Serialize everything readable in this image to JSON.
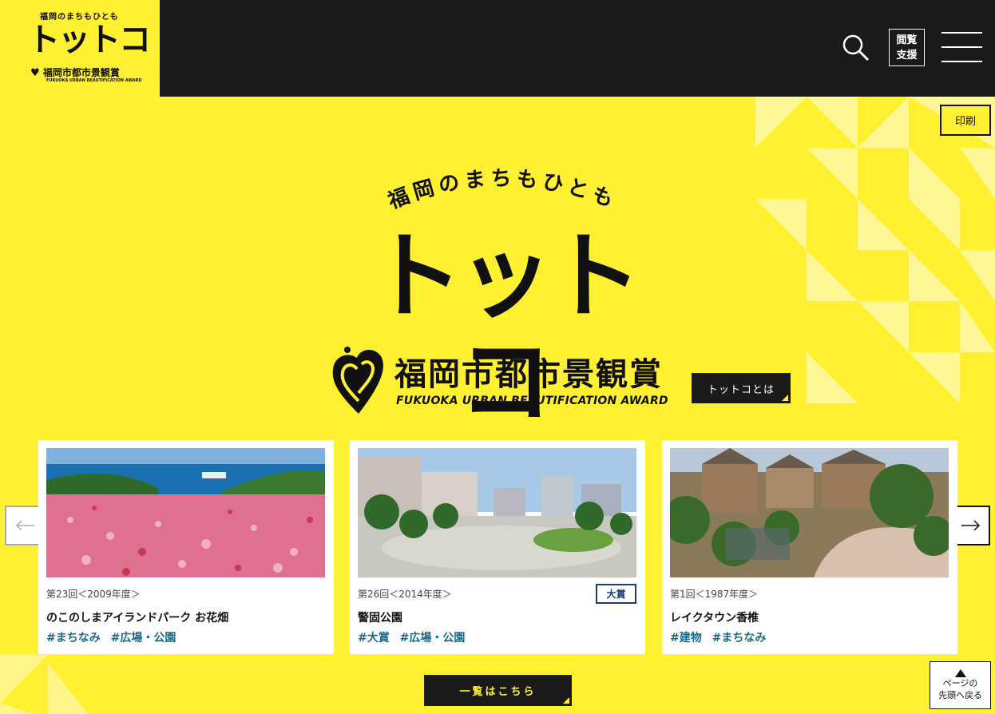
{
  "logo": {
    "sub": "福岡のまちもひとも",
    "main": "トットコ",
    "award": "福岡市都市景観賞",
    "award_en": "FUKUOKA URBAN BEAUTIFICATION AWARD"
  },
  "header": {
    "assist_line1": "閲覧",
    "assist_line2": "支援"
  },
  "print_label": "印刷",
  "hero": {
    "subtitle": "福岡のまちもひとも",
    "title": "トットコ",
    "award_jp": "福岡市都市景観賞",
    "award_en": "FUKUOKA URBAN BEAUTIFICATION AWARD",
    "about_label": "トットコとは"
  },
  "cards": [
    {
      "edition": "第23回＜2009年度＞",
      "title": "のこのしまアイランドパーク お花畑",
      "tags": [
        "#まちなみ",
        "#広場・公園"
      ],
      "badge": ""
    },
    {
      "edition": "第26回＜2014年度＞",
      "title": "警固公園",
      "tags": [
        "#大賞",
        "#広場・公園"
      ],
      "badge": "大賞"
    },
    {
      "edition": "第1回＜1987年度＞",
      "title": "レイクタウン香椎",
      "tags": [
        "#建物",
        "#まちなみ"
      ],
      "badge": ""
    }
  ],
  "list_label": "一覧はこちら",
  "back_to_top": {
    "line1": "ページの",
    "line2": "先頭へ戻る"
  },
  "colors": {
    "brand_yellow": "#fff032",
    "header_dark": "#1a1a1a",
    "tag_blue": "#1a6a8a",
    "badge_navy": "#1a3a7a"
  }
}
